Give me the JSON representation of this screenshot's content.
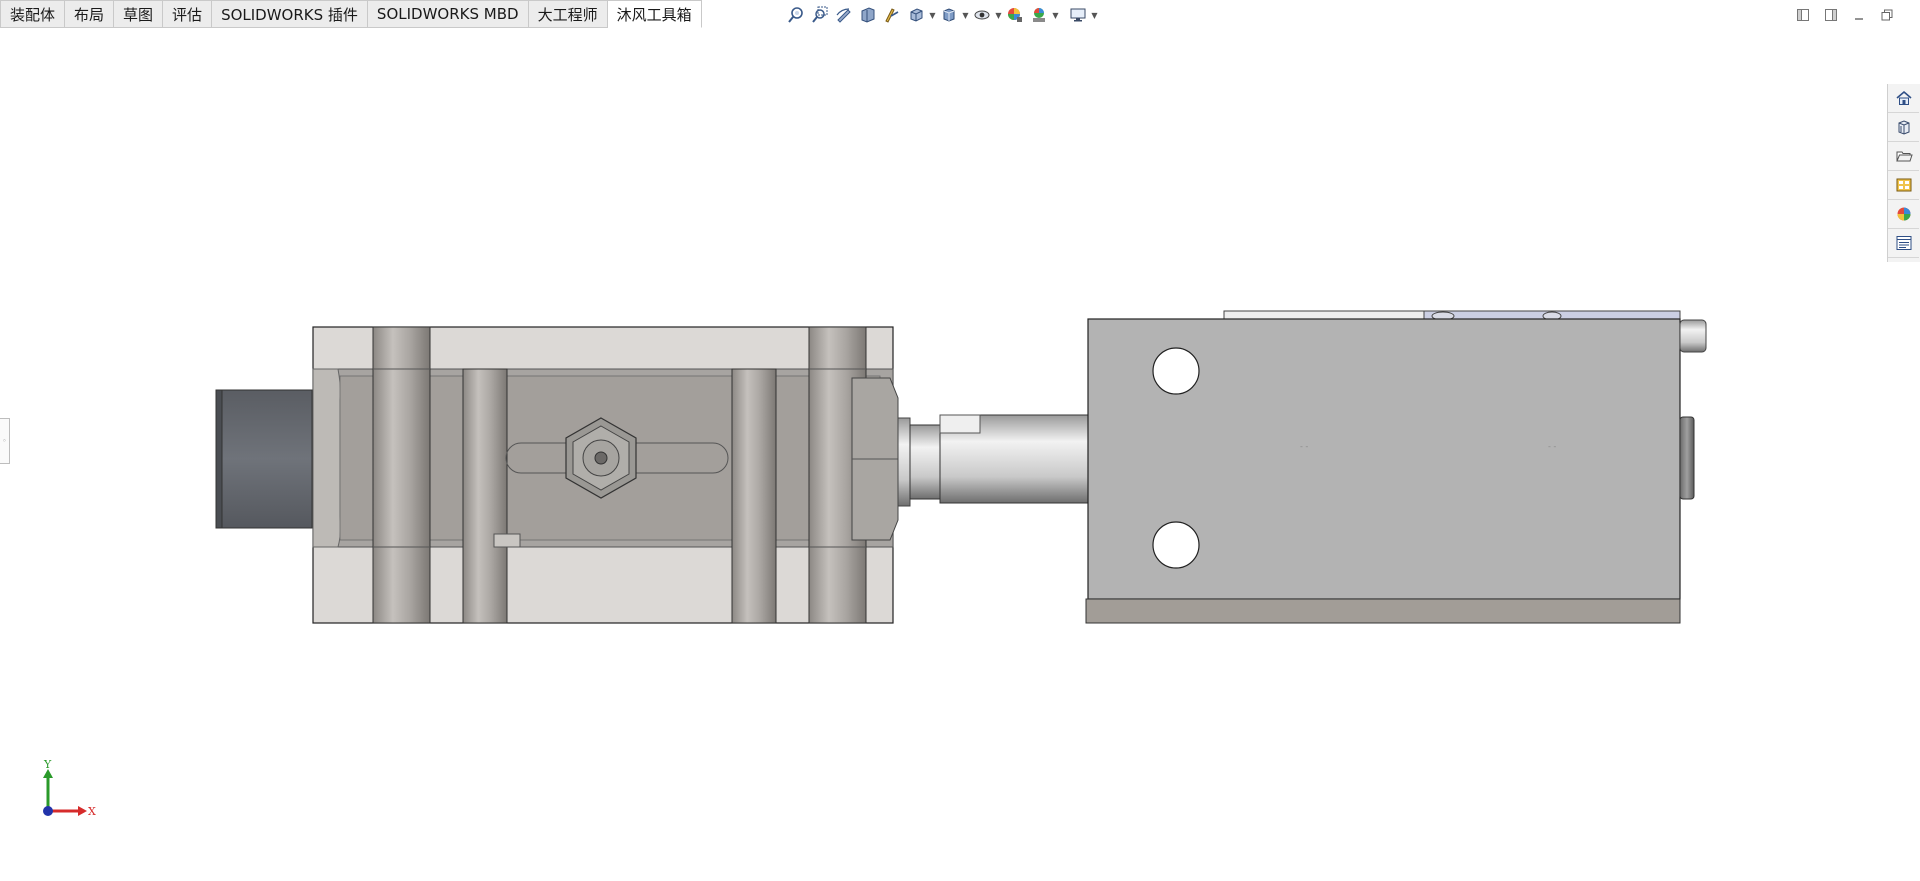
{
  "tabs": [
    {
      "label": "装配体",
      "active": false
    },
    {
      "label": "布局",
      "active": false
    },
    {
      "label": "草图",
      "active": false
    },
    {
      "label": "评估",
      "active": false
    },
    {
      "label": "SOLIDWORKS 插件",
      "active": false
    },
    {
      "label": "SOLIDWORKS MBD",
      "active": false
    },
    {
      "label": "大工程师",
      "active": false
    },
    {
      "label": "沐风工具箱",
      "active": true
    }
  ],
  "heads_up_toolbar": [
    {
      "icon": "zoom-to-fit-icon"
    },
    {
      "icon": "zoom-to-area-icon"
    },
    {
      "icon": "previous-view-icon"
    },
    {
      "icon": "section-view-icon"
    },
    {
      "icon": "dynamic-annotation-icon"
    },
    {
      "icon": "view-orientation-icon",
      "dropdown": true
    },
    {
      "icon": "display-style-icon",
      "dropdown": true
    },
    {
      "icon": "hide-show-items-icon",
      "dropdown": true
    },
    {
      "icon": "edit-appearance-icon"
    },
    {
      "icon": "apply-scene-icon",
      "dropdown": true
    },
    {
      "icon": "view-settings-icon",
      "dropdown": true
    }
  ],
  "window_controls": [
    "tile-left-icon",
    "tile-right-icon",
    "minimize-icon",
    "restore-icon"
  ],
  "task_pane": [
    {
      "icon": "solidworks-resources-icon"
    },
    {
      "icon": "design-library-icon"
    },
    {
      "icon": "file-explorer-icon"
    },
    {
      "icon": "view-palette-icon"
    },
    {
      "icon": "appearances-scenes-icon"
    },
    {
      "icon": "custom-properties-icon"
    }
  ],
  "triad": {
    "x_label": "X",
    "y_label": "Y"
  },
  "colors": {
    "accent_axis_x": "#d62b2b",
    "accent_axis_y": "#2a9a2a",
    "accent_axis_origin": "#2233aa",
    "body_gray": "#b3b3b3",
    "block_light": "#dcd9d6"
  }
}
